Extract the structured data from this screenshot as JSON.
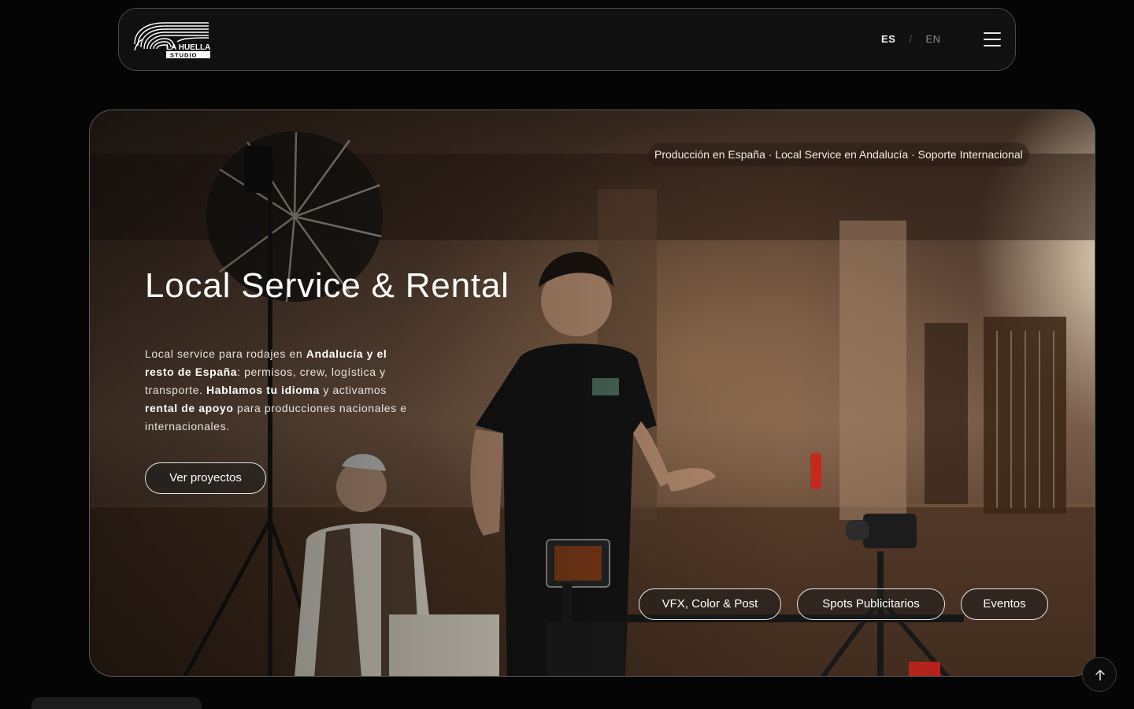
{
  "header": {
    "logo_text_line1": "LA HUELLA",
    "logo_text_line2": "STUDIO",
    "lang_es": "ES",
    "lang_separator": "/",
    "lang_en": "EN",
    "menu_icon": "hamburger-menu-icon"
  },
  "hero": {
    "tagline": "Producción en España · Local Service en Andalucía · Soporte Internacional",
    "title": "Local Service & Rental",
    "description": {
      "t1": "Local service para rodajes en ",
      "b1": "Andalucía y el resto de España",
      "t2": ": permisos, crew, logística y transporte. ",
      "b2": "Hablamos tu idioma",
      "t3": " y activamos ",
      "b3": "rental de apoyo",
      "t4": " para producciones nacionales e internacionales."
    },
    "cta_label": "Ver proyectos",
    "categories": [
      "VFX, Color & Post",
      "Spots Publicitarios",
      "Eventos"
    ]
  },
  "scroll_top_icon": "arrow-up-icon",
  "colors": {
    "background": "#050505",
    "header_bg": "#101010",
    "border": "#4a4a4a",
    "text": "#ffffff"
  }
}
